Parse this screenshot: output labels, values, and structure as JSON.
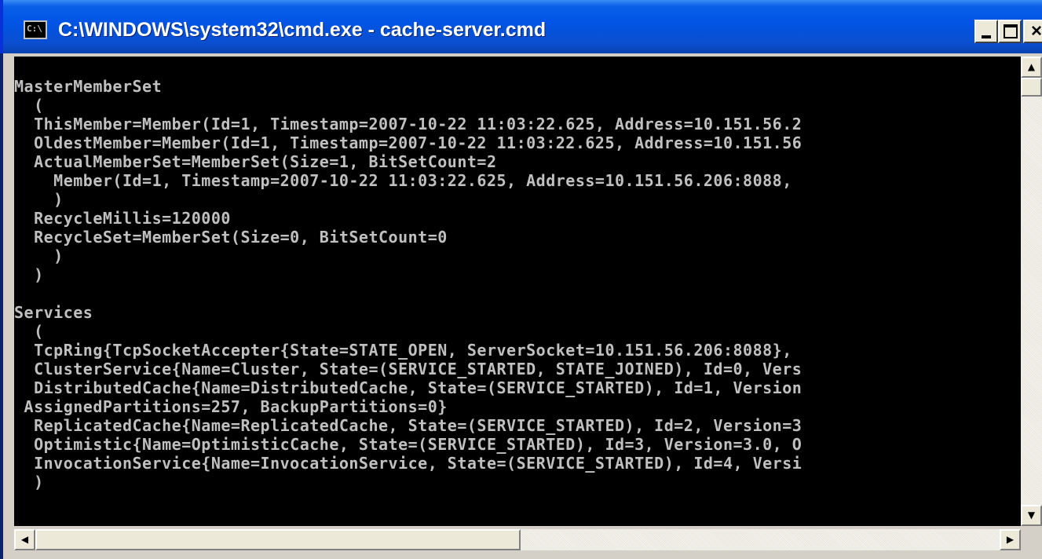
{
  "window": {
    "title": "C:\\WINDOWS\\system32\\cmd.exe - cache-server.cmd",
    "icon_label": "C:\\",
    "controls": {
      "minimize": "minimize-icon",
      "maximize": "maximize-icon",
      "close": "×"
    }
  },
  "console": {
    "lines": [
      "MasterMemberSet",
      "  (",
      "  ThisMember=Member(Id=1, Timestamp=2007-10-22 11:03:22.625, Address=10.151.56.2",
      "  OldestMember=Member(Id=1, Timestamp=2007-10-22 11:03:22.625, Address=10.151.56",
      "  ActualMemberSet=MemberSet(Size=1, BitSetCount=2",
      "    Member(Id=1, Timestamp=2007-10-22 11:03:22.625, Address=10.151.56.206:8088,",
      "    )",
      "  RecycleMillis=120000",
      "  RecycleSet=MemberSet(Size=0, BitSetCount=0",
      "    )",
      "  )",
      "",
      "Services",
      "  (",
      "  TcpRing{TcpSocketAccepter{State=STATE_OPEN, ServerSocket=10.151.56.206:8088},",
      "  ClusterService{Name=Cluster, State=(SERVICE_STARTED, STATE_JOINED), Id=0, Vers",
      "  DistributedCache{Name=DistributedCache, State=(SERVICE_STARTED), Id=1, Version",
      " AssignedPartitions=257, BackupPartitions=0}",
      "  ReplicatedCache{Name=ReplicatedCache, State=(SERVICE_STARTED), Id=2, Version=3",
      "  Optimistic{Name=OptimisticCache, State=(SERVICE_STARTED), Id=3, Version=3.0, O",
      "  InvocationService{Name=InvocationService, State=(SERVICE_STARTED), Id=4, Versi",
      "  )"
    ]
  },
  "scrollbars": {
    "up_glyph": "▲",
    "down_glyph": "▼",
    "left_glyph": "◀",
    "right_glyph": "▶"
  },
  "colors": {
    "title_bar": "#0055e5",
    "console_bg": "#000000",
    "console_text": "#c0c0c0"
  }
}
